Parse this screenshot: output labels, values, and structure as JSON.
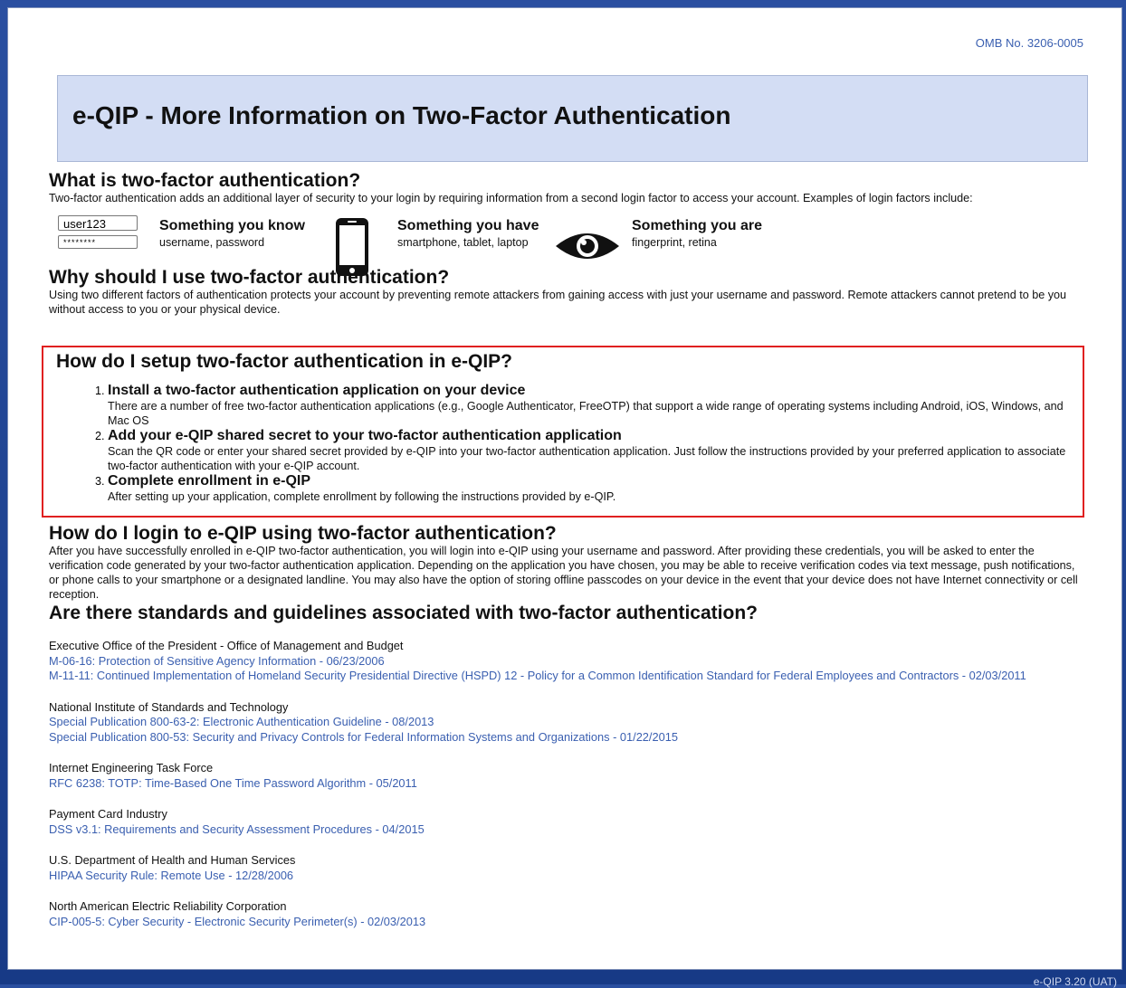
{
  "omb": "OMB No. 3206-0005",
  "title": "e-QIP - More Information on Two-Factor Authentication",
  "what": {
    "heading": "What is two-factor authentication?",
    "text": "Two-factor authentication adds an additional layer of security to your login by requiring information from a second login factor to access your account. Examples of login factors include:",
    "username_sample": "user123",
    "password_sample": "********",
    "know_title": "Something you know",
    "know_sub": "username, password",
    "have_title": "Something you have",
    "have_sub": "smartphone, tablet, laptop",
    "are_title": "Something you are",
    "are_sub": "fingerprint, retina"
  },
  "why": {
    "heading": "Why should I use two-factor authentication?",
    "text": "Using two different factors of authentication protects your account by preventing remote attackers from gaining access with just your username and password. Remote attackers cannot pretend to be you without access to you or your physical device."
  },
  "setup": {
    "heading": "How do I setup two-factor authentication in e-QIP?",
    "steps": [
      {
        "title": "Install a two-factor authentication application on your device",
        "desc": "There are a number of free two-factor authentication applications (e.g., Google Authenticator, FreeOTP) that support a wide range of operating systems including Android, iOS, Windows, and Mac OS"
      },
      {
        "title": "Add your e-QIP shared secret to your two-factor authentication application",
        "desc": "Scan the QR code or enter your shared secret provided by e-QIP into your two-factor authentication application. Just follow the instructions provided by your preferred application to associate two-factor authentication with your e-QIP account."
      },
      {
        "title": "Complete enrollment in e-QIP",
        "desc": "After setting up your application, complete enrollment by following the instructions provided by e-QIP."
      }
    ]
  },
  "login": {
    "heading": "How do I login to e-QIP using two-factor authentication?",
    "text": "After you have successfully enrolled in e-QIP two-factor authentication, you will login into e-QIP using your username and password. After providing these credentials, you will be asked to enter the verification code generated by your two-factor authentication application. Depending on the application you have chosen, you may be able to receive verification codes via text message, push notifications, or phone calls to your smartphone or a designated landline. You may also have the option of storing offline passcodes on your device in the event that your device does not have Internet connectivity or cell reception."
  },
  "standards": {
    "heading": "Are there standards and guidelines associated with two-factor authentication?",
    "groups": [
      {
        "org": "Executive Office of the President - Office of Management and Budget",
        "links": [
          "M-06-16: Protection of Sensitive Agency Information - 06/23/2006",
          "M-11-11: Continued Implementation of Homeland Security Presidential Directive (HSPD) 12 - Policy for a Common Identification Standard for Federal Employees and Contractors - 02/03/2011"
        ]
      },
      {
        "org": "National Institute of Standards and Technology",
        "links": [
          "Special Publication 800-63-2: Electronic Authentication Guideline - 08/2013",
          "Special Publication 800-53: Security and Privacy Controls for Federal Information Systems and Organizations - 01/22/2015"
        ]
      },
      {
        "org": "Internet Engineering Task Force",
        "links": [
          "RFC 6238: TOTP: Time-Based One Time Password Algorithm - 05/2011"
        ]
      },
      {
        "org": "Payment Card Industry",
        "links": [
          "DSS v3.1: Requirements and Security Assessment Procedures - 04/2015"
        ]
      },
      {
        "org": "U.S. Department of Health and Human Services",
        "links": [
          "HIPAA Security Rule: Remote Use - 12/28/2006"
        ]
      },
      {
        "org": "North American Electric Reliability Corporation",
        "links": [
          "CIP-005-5: Cyber Security - Electronic Security Perimeter(s) - 02/03/2013"
        ]
      }
    ]
  },
  "version": "e-QIP 3.20 (UAT)",
  "colors": {
    "link": "#3a5fb0",
    "banner_bg": "#d3ddf4",
    "highlight_border": "#e02020",
    "frame_bg": "#1b3d8a"
  }
}
